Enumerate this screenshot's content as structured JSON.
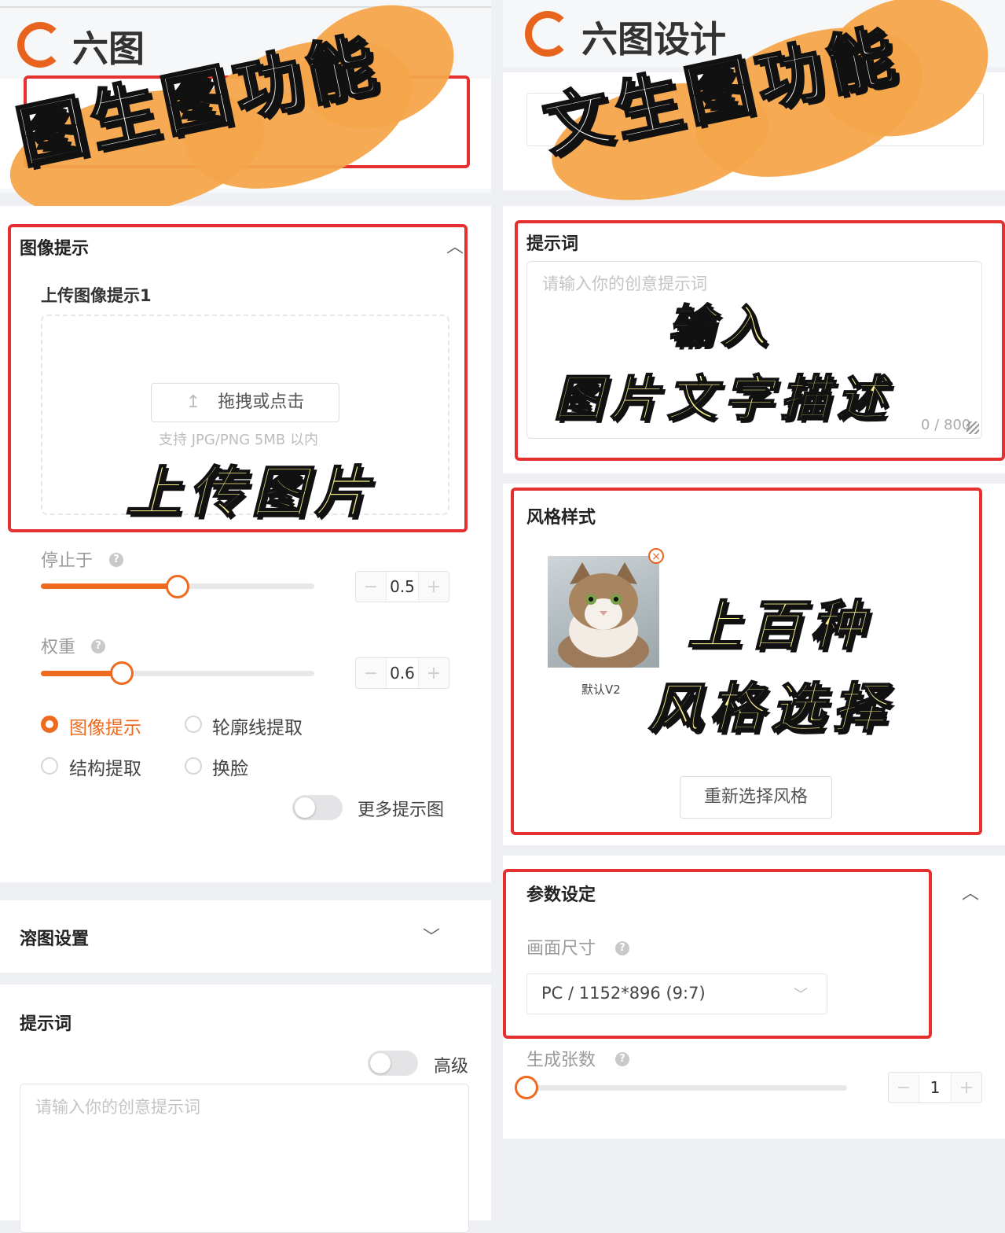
{
  "left": {
    "logo_text": "六图",
    "banner": "图生图功能",
    "image_prompt_section": {
      "title": "图像提示",
      "upload_title": "上传图像提示1",
      "upload_button": "拖拽或点击",
      "upload_hint": "支持 JPG/PNG 5MB 以内",
      "overlay": "上传图片"
    },
    "stop_at": {
      "label": "停止于",
      "value": "0.5",
      "fraction": 0.5
    },
    "weight": {
      "label": "权重",
      "value": "0.6",
      "fraction": 0.3
    },
    "modes": [
      {
        "label": "图像提示",
        "selected": true
      },
      {
        "label": "轮廓线提取",
        "selected": false
      },
      {
        "label": "结构提取",
        "selected": false
      },
      {
        "label": "换脸",
        "selected": false
      }
    ],
    "more_prompts_label": "更多提示图",
    "blend_settings": "溶图设置",
    "prompt_section": {
      "title": "提示词",
      "advanced_label": "高级",
      "placeholder": "请输入你的创意提示词"
    }
  },
  "right": {
    "logo_text": "六图设计",
    "banner": "文生图功能",
    "prompt_section": {
      "title": "提示词",
      "placeholder": "请输入你的创意提示词",
      "counter": "0 / 800",
      "overlay_line1": "输入",
      "overlay_line2": "图片文字描述"
    },
    "style_section": {
      "title": "风格样式",
      "style_name": "默认V2",
      "reselect_button": "重新选择风格",
      "overlay_line1": "上百种",
      "overlay_line2": "风格选择"
    },
    "params_section": {
      "title": "参数设定",
      "size_label": "画面尺寸",
      "size_value": "PC / 1152*896 (9:7)"
    },
    "count": {
      "label": "生成张数",
      "value": "1",
      "fraction": 0
    }
  },
  "colors": {
    "accent": "#ee6a1f",
    "highlight_border": "#e53030",
    "banner_blob": "#f4a54a"
  }
}
